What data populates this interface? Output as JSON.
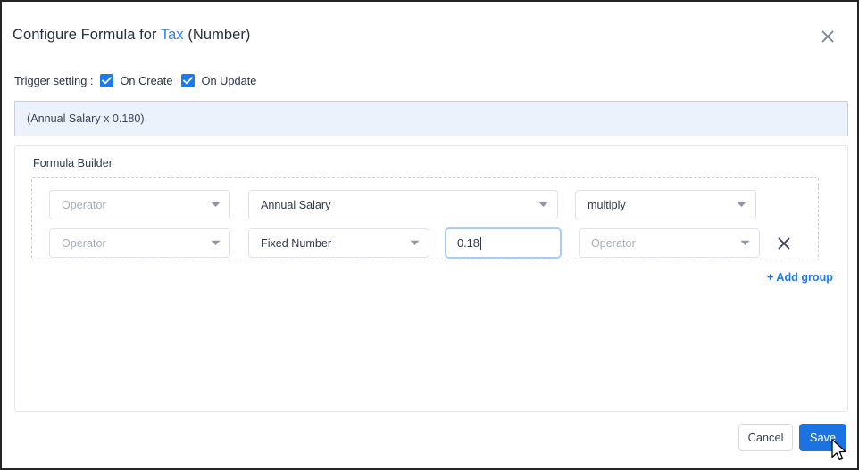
{
  "dialog": {
    "title_prefix": "Configure Formula for ",
    "field_name": "Tax",
    "title_suffix": " (Number)",
    "close_icon": "close-icon"
  },
  "trigger": {
    "label": "Trigger setting :",
    "options": [
      {
        "label": "On Create",
        "checked": true
      },
      {
        "label": "On Update",
        "checked": true
      }
    ]
  },
  "preview": {
    "expression": "(Annual Salary x 0.180)"
  },
  "builder": {
    "label": "Formula Builder",
    "rows": [
      {
        "operator_left": "Operator",
        "operator_left_placeholder": true,
        "field": "Annual Salary",
        "field_placeholder": false,
        "operator_right": "multiply",
        "operator_right_placeholder": false
      },
      {
        "operator_left": "Operator",
        "operator_left_placeholder": true,
        "type": "Fixed Number",
        "type_placeholder": false,
        "number_value": "0.18",
        "operator_right": "Operator",
        "operator_right_placeholder": true,
        "remove_icon": "close-icon"
      }
    ],
    "add_group": {
      "plus": "+",
      "label": "Add group"
    }
  },
  "footer": {
    "cancel_label": "Cancel",
    "save_label": "Save"
  },
  "colors": {
    "accent": "#1a7cec",
    "save_button": "#1a73e0",
    "link": "#2f7fe4",
    "preview_bg": "#ebf2fb",
    "focus_border": "#a9ccf3"
  }
}
